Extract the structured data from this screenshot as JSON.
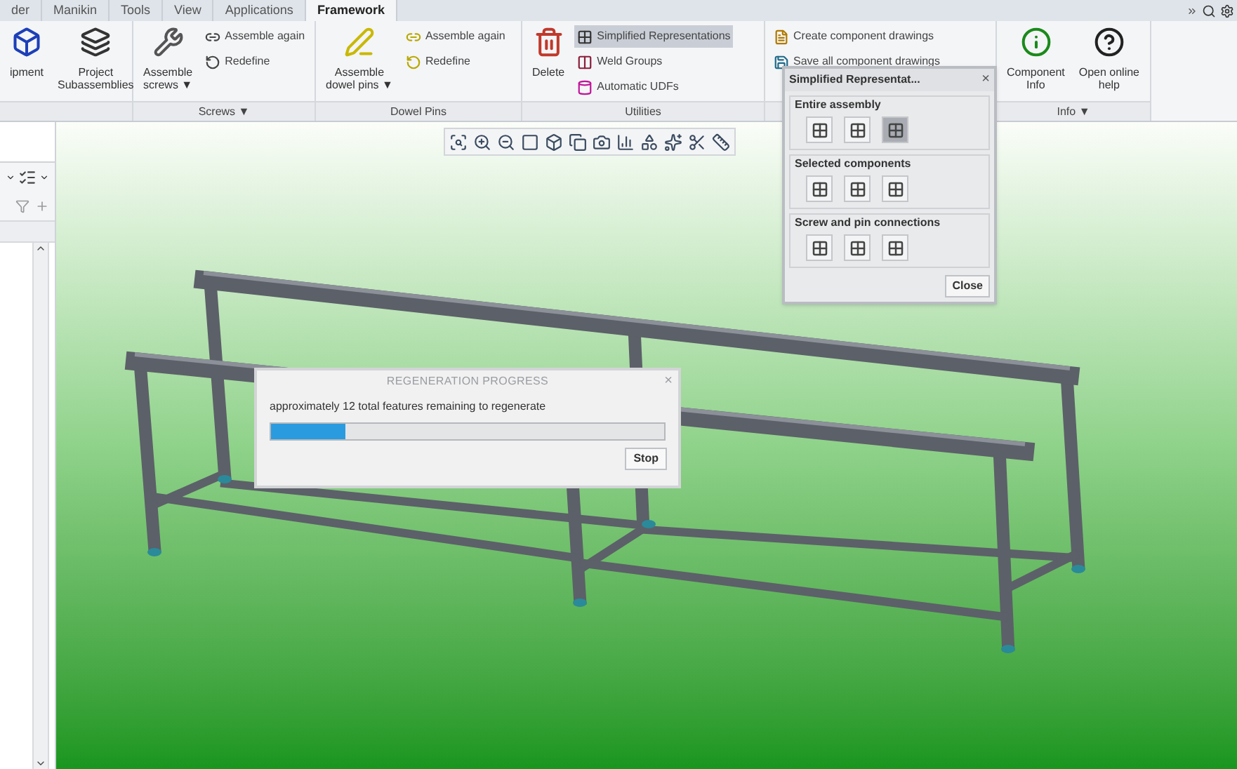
{
  "tabs": [
    {
      "label": "der",
      "selected": false
    },
    {
      "label": "Manikin",
      "selected": false
    },
    {
      "label": "Tools",
      "selected": false
    },
    {
      "label": "View",
      "selected": false
    },
    {
      "label": "Applications",
      "selected": false
    },
    {
      "label": "Framework",
      "selected": true
    }
  ],
  "ribbon": {
    "groups": [
      {
        "columns": [
          {
            "kind": "large",
            "label": "ipment",
            "selected": false
          },
          {
            "kind": "large",
            "label": "Project\nSubassemblies",
            "selected": false
          }
        ]
      },
      {
        "label": "Screws ▼",
        "columns": [
          {
            "kind": "large",
            "label": "Assemble\nscrews ▼",
            "selected": false
          },
          {
            "kind": "stack",
            "items": [
              {
                "label": "Assemble again",
                "selected": false
              },
              {
                "label": "Redefine",
                "selected": false
              }
            ]
          }
        ]
      },
      {
        "label": "Dowel Pins",
        "columns": [
          {
            "kind": "large",
            "label": "Assemble\ndowel pins ▼",
            "selected": false
          },
          {
            "kind": "stack",
            "items": [
              {
                "label": "Assemble again",
                "selected": false
              },
              {
                "label": "Redefine",
                "selected": false
              }
            ]
          }
        ]
      },
      {
        "label": "Utilities",
        "columns": [
          {
            "kind": "large",
            "label": "Delete",
            "selected": false
          },
          {
            "kind": "stack",
            "items": [
              {
                "label": "Simplified Representations",
                "selected": true
              },
              {
                "label": "Weld Groups",
                "selected": false
              },
              {
                "label": "Automatic UDFs",
                "selected": false
              }
            ]
          }
        ]
      },
      {
        "columns": [
          {
            "kind": "stack",
            "items": [
              {
                "label": "Create component drawings",
                "selected": false
              },
              {
                "label": "Save all component drawings",
                "selected": false
              }
            ]
          }
        ]
      },
      {
        "label": "Info ▼",
        "columns": [
          {
            "kind": "large",
            "label": "Component\nInfo",
            "selected": false
          },
          {
            "kind": "large",
            "label": "Open online\nhelp",
            "selected": false
          }
        ]
      }
    ]
  },
  "simplified_dialog": {
    "title": "Simplified Representat...",
    "close": "×",
    "sections": [
      {
        "title": "Entire assembly",
        "buttons": [
          {
            "selected": false
          },
          {
            "selected": false
          },
          {
            "selected": true
          }
        ]
      },
      {
        "title": "Selected components",
        "buttons": [
          {
            "selected": false
          },
          {
            "selected": false
          },
          {
            "selected": false
          }
        ]
      },
      {
        "title": "Screw and pin connections",
        "buttons": [
          {
            "selected": false
          },
          {
            "selected": false
          },
          {
            "selected": false
          }
        ]
      }
    ],
    "button": "Close"
  },
  "regeneration_dialog": {
    "title": "REGENERATION PROGRESS",
    "close": "×",
    "message": "approximately 12 total features remaining to regenerate",
    "level": 0.19,
    "button": "Stop"
  }
}
